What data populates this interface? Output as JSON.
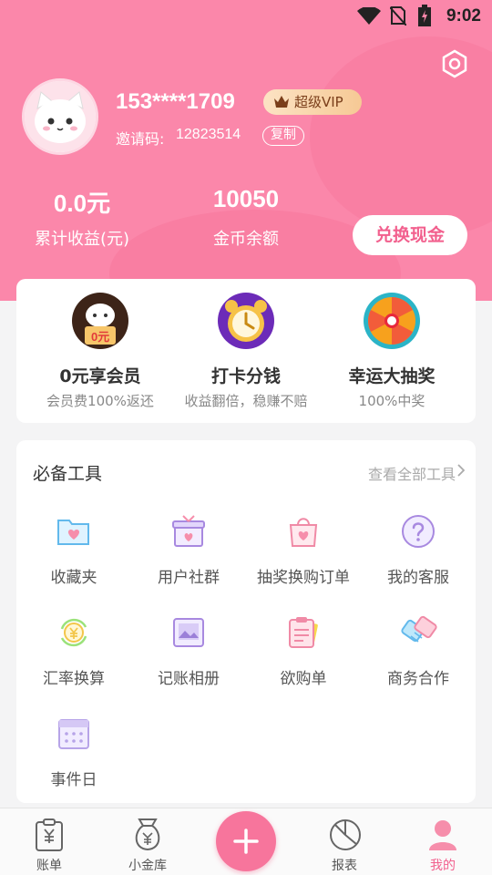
{
  "status_bar": {
    "time": "9:02"
  },
  "profile": {
    "phone": "153****1709",
    "vip_label": "超级VIP",
    "invite_label": "邀请码:",
    "invite_code": "12823514",
    "copy_label": "复制"
  },
  "stats": [
    {
      "value": "0.0元",
      "label": "累计收益(元)"
    },
    {
      "value": "10050",
      "label": "金币余额"
    }
  ],
  "exchange_label": "兑换现金",
  "features": [
    {
      "title": "0元享会员",
      "subtitle": "会员费100%返还",
      "badge": "0元"
    },
    {
      "title": "打卡分钱",
      "subtitle": "收益翻倍，稳赚不赔"
    },
    {
      "title": "幸运大抽奖",
      "subtitle": "100%中奖"
    }
  ],
  "tools": {
    "title": "必备工具",
    "view_all": "查看全部工具",
    "items": [
      {
        "label": "收藏夹",
        "icon": "folder-heart-icon"
      },
      {
        "label": "用户社群",
        "icon": "gift-box-icon"
      },
      {
        "label": "抽奖换购订单",
        "icon": "shopping-bag-icon"
      },
      {
        "label": "我的客服",
        "icon": "question-icon"
      },
      {
        "label": "汇率换算",
        "icon": "exchange-rate-icon"
      },
      {
        "label": "记账相册",
        "icon": "photo-album-icon"
      },
      {
        "label": "欲购单",
        "icon": "clipboard-icon"
      },
      {
        "label": "商务合作",
        "icon": "handshake-icon"
      },
      {
        "label": "事件日",
        "icon": "calendar-icon"
      }
    ]
  },
  "tabbar": {
    "items": [
      {
        "label": "账单",
        "icon": "bill-icon"
      },
      {
        "label": "小金库",
        "icon": "money-bag-icon"
      },
      {
        "label": "报表",
        "icon": "pie-chart-icon"
      },
      {
        "label": "我的",
        "icon": "user-icon",
        "active": true
      }
    ]
  },
  "colors": {
    "accent": "#f97ea2",
    "accent_text": "#f2608e",
    "header": "#fb87aa"
  }
}
